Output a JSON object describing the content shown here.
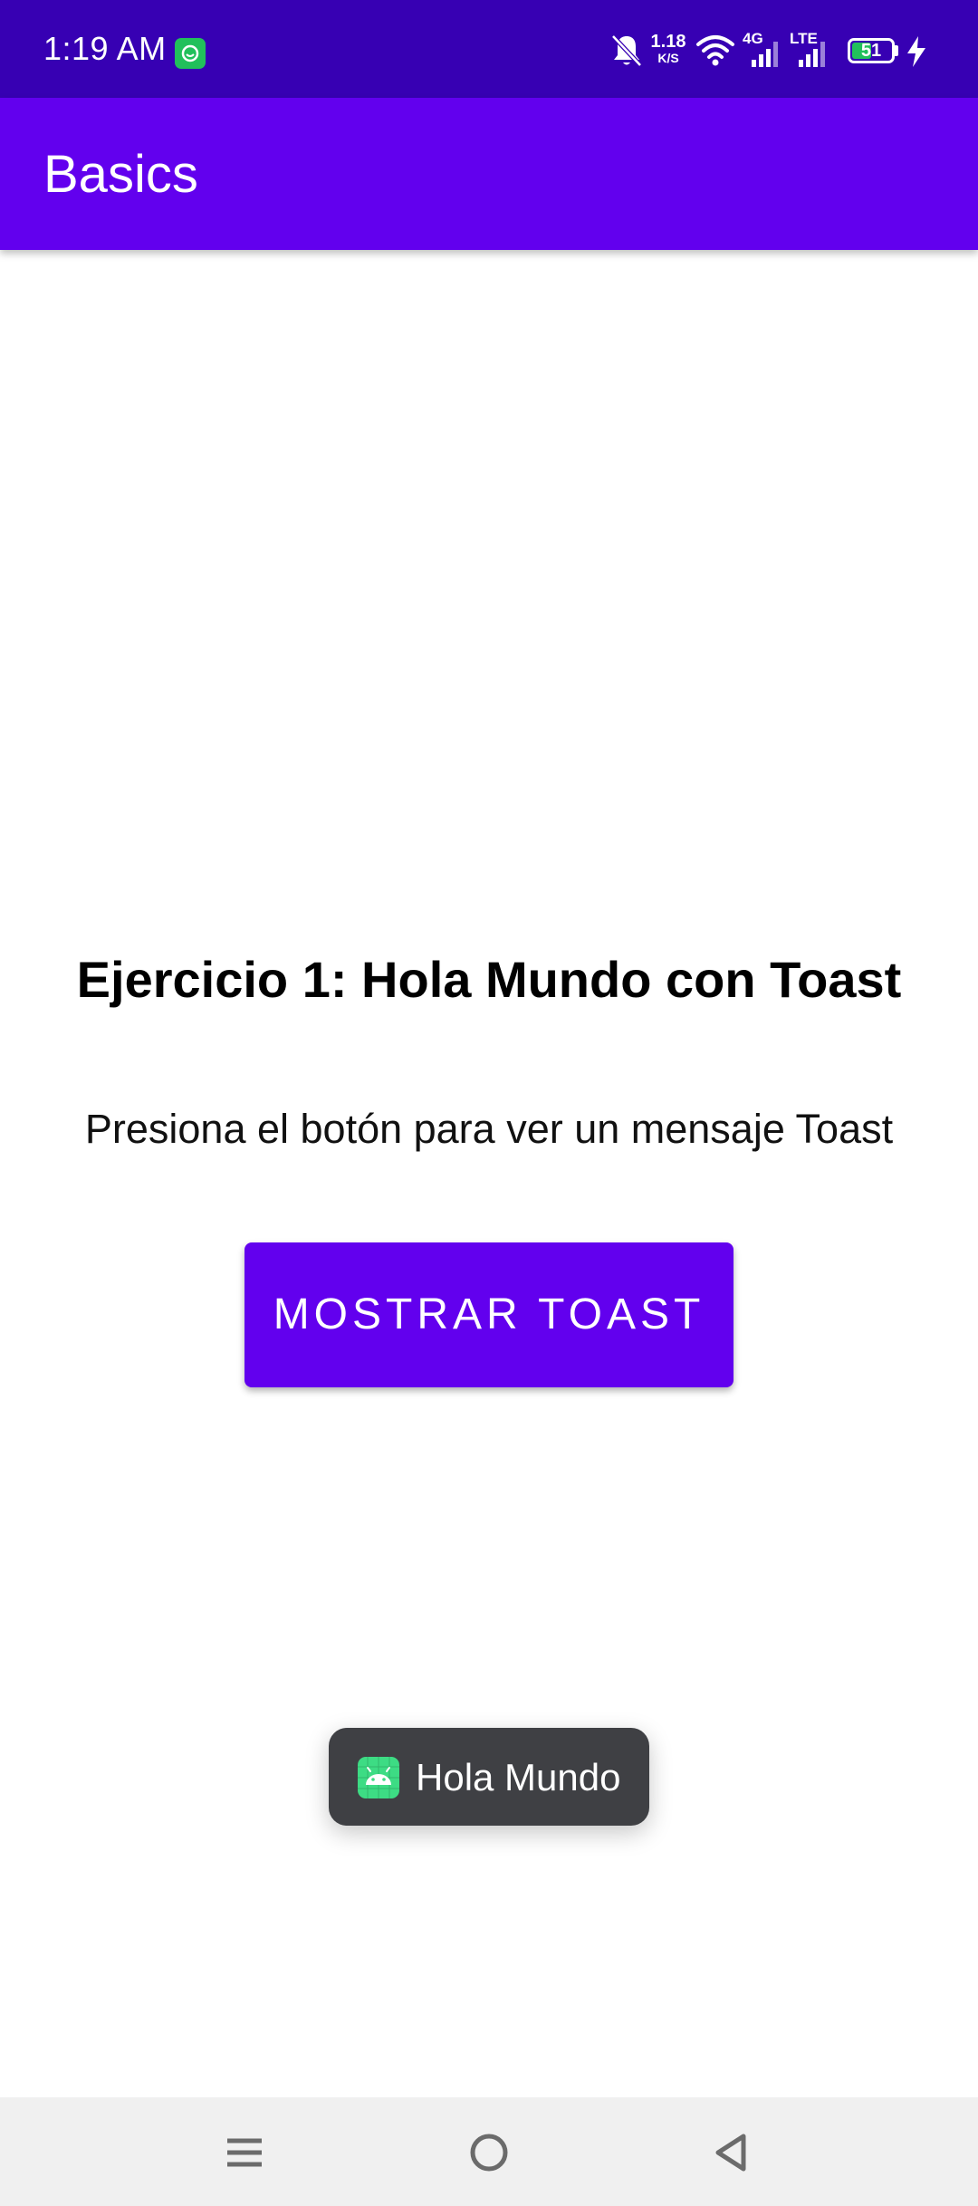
{
  "status_bar": {
    "time": "1:19 AM",
    "net_speed_value": "1.18",
    "net_speed_unit": "K/S",
    "network_type_1": "4G",
    "network_type_2": "LTE",
    "battery_level": "51",
    "icons": [
      "notification-app-icon",
      "bell-off-icon",
      "wifi-icon",
      "signal-4g-icon",
      "signal-lte-icon",
      "battery-icon",
      "charging-bolt-icon"
    ]
  },
  "app_bar": {
    "title": "Basics"
  },
  "main": {
    "heading": "Ejercicio 1: Hola Mundo con Toast",
    "instruction": "Presiona el botón para ver un mensaje Toast",
    "button_label": "MOSTRAR TOAST"
  },
  "toast": {
    "message": "Hola Mundo",
    "icon": "android-app-icon"
  },
  "nav_bar": {
    "buttons": [
      "menu-icon",
      "home-icon",
      "back-icon"
    ]
  },
  "colors": {
    "status_bar": "#3700B3",
    "primary": "#6200EE",
    "toast_bg": "#3f4044",
    "nav_bar": "#f0f0f0",
    "battery_fill": "#21c05b",
    "android_green": "#3ddc84"
  }
}
